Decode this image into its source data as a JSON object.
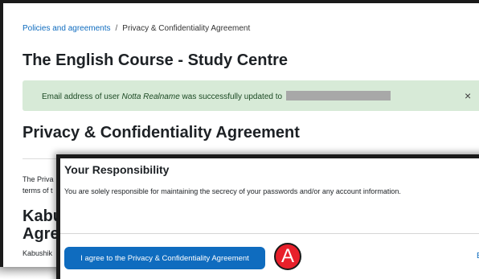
{
  "breadcrumb": {
    "parent": "Policies and agreements",
    "separator": "/",
    "current": "Privacy & Confidentiality Agreement"
  },
  "course_title": "The English Course - Study Centre",
  "alert": {
    "prefix": "Email address of user ",
    "user_name": "Notta Realname",
    "suffix": " was successfully updated to",
    "close_icon": "×",
    "color": "#d7ead7"
  },
  "section_title": "Privacy & Confidentiality Agreement",
  "back_content": {
    "line1": "The Priva",
    "line2": "terms of t",
    "heading_line1": "Kabu",
    "heading_line2": "Agre",
    "footer_line": "Kabushik"
  },
  "modal": {
    "title": "Your Responsibility",
    "text": "You are solely responsible for maintaining the secrecy of your passwords and/or any account information.",
    "agree_button": "I agree to the Privacy & Confidentiality Agreement",
    "back_link": "Ba"
  },
  "annotation_marker": "A",
  "colors": {
    "primary": "#0f6cbf",
    "marker": "#e8202b",
    "success_bg": "#d7ead7"
  }
}
